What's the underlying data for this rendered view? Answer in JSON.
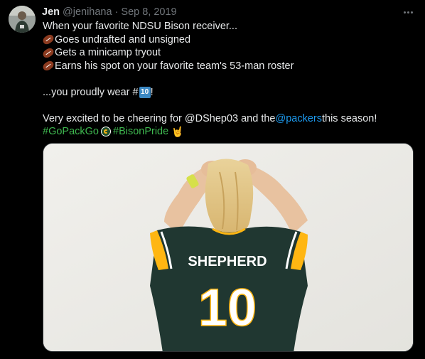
{
  "tweet": {
    "author_name": "Jen",
    "author_handle": "@jenihana",
    "separator": "·",
    "date": "Sep 8, 2019",
    "lines": {
      "l1": "When your favorite NDSU Bison receiver...",
      "l2": "Goes undrafted and unsigned",
      "l3": "Gets a minicamp tryout",
      "l4": "Earns his spot on your favorite team's 53-man roster",
      "l5_pre": "...you proudly wear #",
      "l5_badge": "10",
      "l5_post": "!",
      "l6_pre": "Very excited to be cheering for @DShep03 and the ",
      "l6_link": "@packers",
      "l6_post": " this season!",
      "l7_tag1": "#GoPackGo",
      "l7_tag2": "#BisonPride"
    }
  },
  "media": {
    "jersey_name": "SHEPHERD",
    "jersey_number": "10"
  },
  "icons": [
    "football-icon",
    "keycap-ten-icon",
    "packers-logo-icon",
    "horns-hand-icon",
    "more-options-icon"
  ],
  "colors": {
    "background": "#000000",
    "text": "#e7e9ea",
    "muted": "#71767b",
    "link": "#1d9bf0",
    "hashtag": "#3fb950",
    "jersey_green": "#203731",
    "jersey_gold": "#ffb612"
  }
}
